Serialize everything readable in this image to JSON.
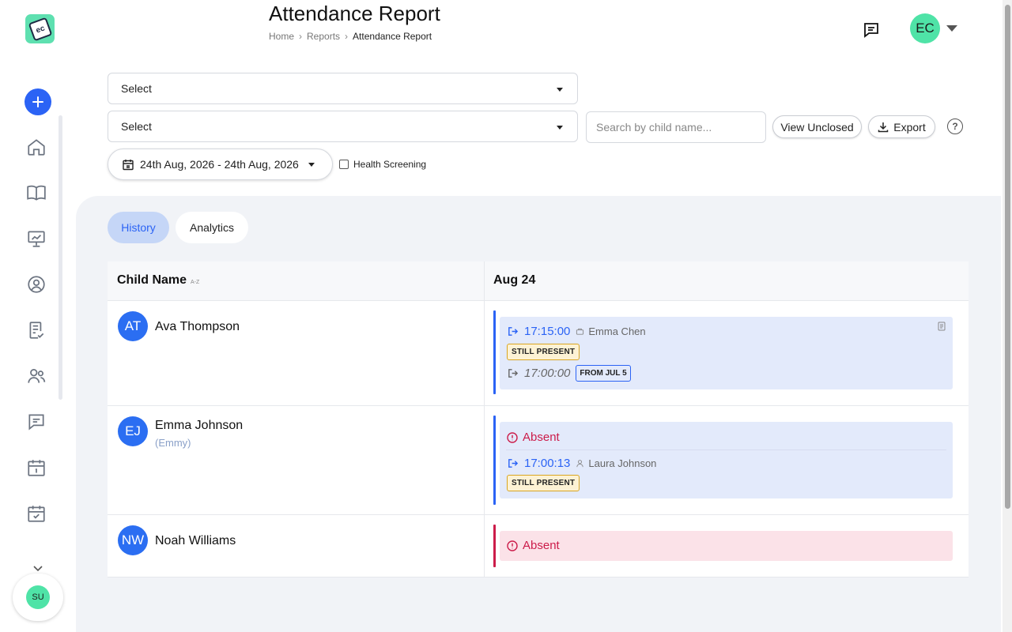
{
  "header": {
    "title": "Attendance Report",
    "breadcrumb": [
      "Home",
      "Reports",
      "Attendance Report"
    ],
    "user_initials": "EC"
  },
  "sidebar": {
    "logo_text": "ec",
    "items": [
      {
        "icon": "home-icon"
      },
      {
        "icon": "book-icon"
      },
      {
        "icon": "presentation-chart-icon"
      },
      {
        "icon": "user-circle-icon"
      },
      {
        "icon": "clipboard-check-icon"
      },
      {
        "icon": "users-icon"
      },
      {
        "icon": "message-icon"
      },
      {
        "icon": "calendar-icon"
      },
      {
        "icon": "calendar-check-icon"
      }
    ],
    "user_initials": "SU"
  },
  "filters": {
    "select1": "Select",
    "select2": "Select",
    "search_placeholder": "Search by child name...",
    "view_unclosed": "View Unclosed",
    "export": "Export",
    "help": "?",
    "date_range": "24th Aug, 2026 - 24th Aug, 2026",
    "health_screening": "Health Screening"
  },
  "tabs": [
    {
      "label": "History",
      "active": true
    },
    {
      "label": "Analytics",
      "active": false
    }
  ],
  "table": {
    "col_name": "Child Name",
    "sort_hint": "A-Z",
    "col_date": "Aug 24",
    "rows": [
      {
        "initials": "AT",
        "name": "Ava Thompson",
        "checkin_time": "17:15:00",
        "checkin_by": "Emma Chen",
        "status": "STILL PRESENT",
        "checkout_time": "17:00:00",
        "checkout_badge": "FROM JUL 5"
      },
      {
        "initials": "EJ",
        "name": "Emma Johnson",
        "nickname": "(Emmy)",
        "absent_label": "Absent",
        "checkin_time": "17:00:13",
        "checkin_by": "Laura Johnson",
        "status": "STILL PRESENT"
      },
      {
        "initials": "NW",
        "name": "Noah Williams",
        "absent_label": "Absent"
      }
    ]
  },
  "colors": {
    "accent": "#2b63f5",
    "mint": "#4fe3a7",
    "absent_red": "#cc1c4a",
    "card_blue": "#e3eafb",
    "card_pink": "#fbe2e8"
  }
}
